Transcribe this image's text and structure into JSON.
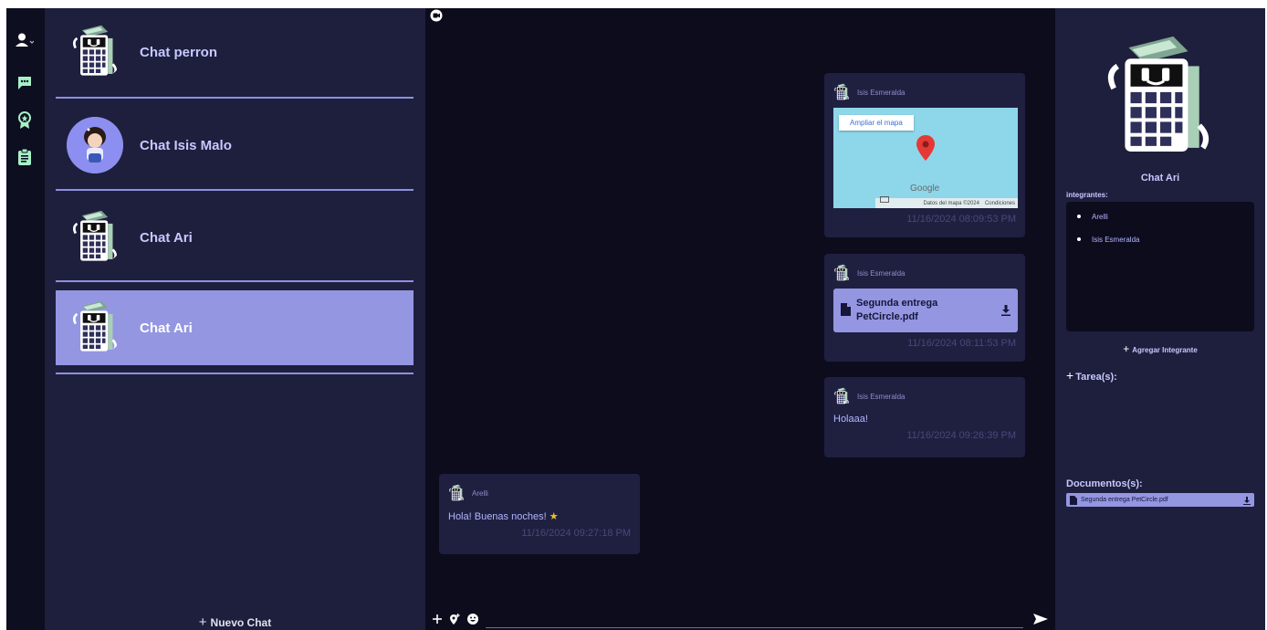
{
  "chat_list": {
    "items": [
      {
        "name": "Chat perron",
        "avatar": "mascot"
      },
      {
        "name": "Chat Isis Malo",
        "avatar": "photo"
      },
      {
        "name": "Chat Ari",
        "avatar": "mascot"
      },
      {
        "name": "Chat Ari",
        "avatar": "mascot",
        "active": true
      }
    ],
    "new_chat_label": "Nuevo Chat"
  },
  "rail": {
    "icons": [
      "user-icon",
      "chat-bubble-icon",
      "award-icon",
      "clipboard-icon"
    ]
  },
  "messages": [
    {
      "sender": "Isis Esmeralda",
      "type": "map",
      "map": {
        "button": "Ampliar el mapa",
        "brand": "Google",
        "data": "Datos del mapa ©2024",
        "terms": "Condiciones"
      },
      "time": "11/16/2024 08:09:53 PM"
    },
    {
      "sender": "Isis Esmeralda",
      "type": "file",
      "file_name": "Segunda entrega PetCircle.pdf",
      "time": "11/16/2024 08:11:53 PM"
    },
    {
      "sender": "Isis Esmeralda",
      "type": "text",
      "text": "Holaaa!",
      "time": "11/16/2024 09:26:39 PM"
    },
    {
      "sender": "Arelli",
      "type": "text",
      "text": "Hola! Buenas noches!",
      "emoji": "★",
      "time": "11/16/2024 09:27:18 PM"
    }
  ],
  "info": {
    "chat_title": "Chat Ari",
    "members_label": "integrantes:",
    "members": [
      "Arelli",
      "Isis Esmeralda"
    ],
    "add_member_label": "Agregar Integrante",
    "tasks_label": "Tarea(s):",
    "docs_label": "Documentos(s):",
    "documents": [
      "Segunda entrega PetCircle.pdf"
    ]
  },
  "colors": {
    "accent": "#9496e2",
    "panel": "#1e1f3d",
    "dark": "#0c0c1d",
    "rail_icons": "#a7f0c8"
  }
}
